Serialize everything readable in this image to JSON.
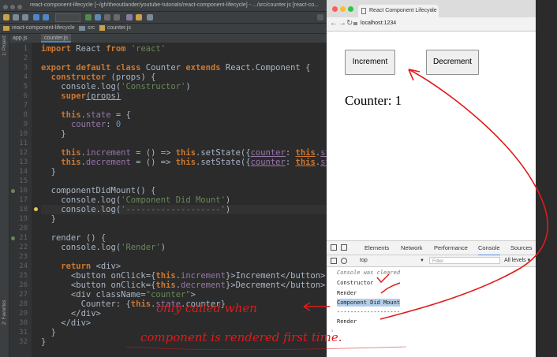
{
  "ide": {
    "window_title": "react-component-lifecycle [~/gh/theoutlander/youtube-tutorials/react-component-lifecycle] - .../src/counter.js [react-co...",
    "breadcrumb": [
      "react-component-lifecycle",
      "src",
      "counter.js"
    ],
    "tabs": [
      {
        "label": "app.js"
      },
      {
        "label": "counter.js"
      }
    ],
    "side_labels": [
      "1: Project",
      "2: Favorites"
    ],
    "line_numbers": [
      "1",
      "2",
      "3",
      "4",
      "5",
      "6",
      "7",
      "8",
      "9",
      "10",
      "11",
      "12",
      "13",
      "14",
      "15",
      "16",
      "17",
      "18",
      "19",
      "20",
      "21",
      "22",
      "23",
      "24",
      "25",
      "26",
      "27",
      "28",
      "29",
      "30",
      "31",
      "32"
    ],
    "code": [
      [
        [
          "kw",
          "import"
        ],
        [
          "t",
          " React "
        ],
        [
          "kw",
          "from"
        ],
        [
          "st",
          " 'react'"
        ]
      ],
      [],
      [
        [
          "kw",
          "export default class"
        ],
        [
          "t",
          " Counter "
        ],
        [
          "kw",
          "extends"
        ],
        [
          "t",
          " React.Component {"
        ]
      ],
      [
        [
          "t",
          "  "
        ],
        [
          "kw",
          "constructor"
        ],
        [
          "t",
          " (props) {"
        ]
      ],
      [
        [
          "t",
          "    console.log("
        ],
        [
          "st",
          "'Constructor'"
        ],
        [
          "t",
          ")"
        ]
      ],
      [
        [
          "t",
          "    "
        ],
        [
          "kw",
          "super"
        ],
        [
          "u",
          "(props)"
        ]
      ],
      [],
      [
        [
          "t",
          "    "
        ],
        [
          "kw",
          "this"
        ],
        [
          "t",
          "."
        ],
        [
          "p",
          "state"
        ],
        [
          "t",
          " = {"
        ]
      ],
      [
        [
          "t",
          "      "
        ],
        [
          "p",
          "counter"
        ],
        [
          "t",
          ": "
        ],
        [
          "n",
          "0"
        ]
      ],
      [
        [
          "t",
          "    }"
        ]
      ],
      [],
      [
        [
          "t",
          "    "
        ],
        [
          "kw",
          "this"
        ],
        [
          "t",
          "."
        ],
        [
          "p",
          "increment"
        ],
        [
          "t",
          " = () => "
        ],
        [
          "kw",
          "this"
        ],
        [
          "t",
          ".setState({"
        ],
        [
          "pu",
          "counter"
        ],
        [
          "t",
          ": "
        ],
        [
          "kwu",
          "this"
        ],
        [
          "t",
          "."
        ],
        [
          "pu",
          "state"
        ]
      ],
      [
        [
          "t",
          "    "
        ],
        [
          "kw",
          "this"
        ],
        [
          "t",
          "."
        ],
        [
          "p",
          "decrement"
        ],
        [
          "t",
          " = () => "
        ],
        [
          "kw",
          "this"
        ],
        [
          "t",
          ".setState({"
        ],
        [
          "pu",
          "counter"
        ],
        [
          "t",
          ": "
        ],
        [
          "kwu",
          "this"
        ],
        [
          "t",
          "."
        ],
        [
          "pu",
          "state"
        ]
      ],
      [
        [
          "t",
          "  }"
        ]
      ],
      [],
      [
        [
          "t",
          "  componentDidMount() {"
        ]
      ],
      [
        [
          "t",
          "    console.log("
        ],
        [
          "st",
          "'Component Did Mount'"
        ],
        [
          "t",
          ")"
        ]
      ],
      [
        [
          "t",
          "    console.log("
        ],
        [
          "st",
          "'-------------------'"
        ],
        [
          "t",
          ")"
        ]
      ],
      [
        [
          "t",
          "  }"
        ]
      ],
      [],
      [
        [
          "t",
          "  render () {"
        ]
      ],
      [
        [
          "t",
          "    console.log("
        ],
        [
          "st",
          "'Render'"
        ],
        [
          "t",
          ")"
        ]
      ],
      [],
      [
        [
          "t",
          "    "
        ],
        [
          "kw",
          "return"
        ],
        [
          "t",
          " <div>"
        ]
      ],
      [
        [
          "t",
          "      <button onClick={"
        ],
        [
          "kw",
          "this"
        ],
        [
          "t",
          "."
        ],
        [
          "p",
          "increment"
        ],
        [
          "t",
          "}>Increment</button>"
        ]
      ],
      [
        [
          "t",
          "      <button onClick={"
        ],
        [
          "kw",
          "this"
        ],
        [
          "t",
          "."
        ],
        [
          "p",
          "decrement"
        ],
        [
          "t",
          "}>Decrement</button>"
        ]
      ],
      [
        [
          "t",
          "      <div className="
        ],
        [
          "st",
          "\"counter\""
        ],
        [
          "t",
          ">"
        ]
      ],
      [
        [
          "t",
          "        Counter: {"
        ],
        [
          "kw",
          "this"
        ],
        [
          "t",
          "."
        ],
        [
          "p",
          "state"
        ],
        [
          "t",
          ".counter}"
        ]
      ],
      [
        [
          "t",
          "      </div>"
        ]
      ],
      [
        [
          "t",
          "    </div>"
        ]
      ],
      [
        [
          "t",
          "  }"
        ]
      ],
      [
        [
          "t",
          "}"
        ]
      ]
    ]
  },
  "browser": {
    "tab_title": "React Component Lifecycle",
    "url": "localhost:1234",
    "buttons": {
      "increment": "Increment",
      "decrement": "Decrement"
    },
    "counter_text": "Counter: 1"
  },
  "devtools": {
    "tabs": [
      "Elements",
      "Network",
      "Performance",
      "Console",
      "Sources"
    ],
    "active_tab": "Console",
    "context": "top",
    "filter_placeholder": "Filter",
    "levels": "All levels ▾",
    "console_lines": [
      "Console was cleared",
      "Constructor",
      "Render",
      "Component Did Mount",
      "-------------------",
      "Render"
    ]
  },
  "annotations": {
    "line1": "only called when",
    "line2": "component is rendered first time.",
    "color": "#e01b1b"
  }
}
